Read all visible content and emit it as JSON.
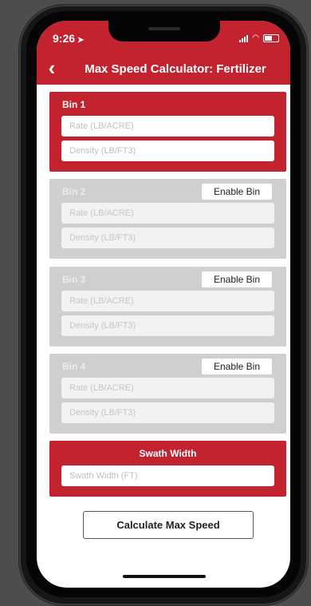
{
  "status_bar": {
    "time": "9:26",
    "location_glyph": "➤"
  },
  "header": {
    "back_glyph": "‹",
    "title": "Max Speed Calculator: Fertilizer"
  },
  "bins": [
    {
      "title": "Bin 1",
      "enabled": true,
      "rate_placeholder": "Rate (LB/ACRE)",
      "density_placeholder": "Density (LB/FT3)"
    },
    {
      "title": "Bin 2",
      "enabled": false,
      "enable_label": "Enable Bin",
      "rate_placeholder": "Rate (LB/ACRE)",
      "density_placeholder": "Density (LB/FT3)"
    },
    {
      "title": "Bin 3",
      "enabled": false,
      "enable_label": "Enable Bin",
      "rate_placeholder": "Rate (LB/ACRE)",
      "density_placeholder": "Density (LB/FT3)"
    },
    {
      "title": "Bin 4",
      "enabled": false,
      "enable_label": "Enable Bin",
      "rate_placeholder": "Rate (LB/ACRE)",
      "density_placeholder": "Density (LB/FT3)"
    }
  ],
  "swath": {
    "title": "Swath Width",
    "placeholder": "Swath Width (FT)"
  },
  "calculate_button": {
    "label": "Calculate Max Speed"
  },
  "colors": {
    "accent": "#c3222f",
    "disabled": "#cfcfcf",
    "background": "#4d4d4d"
  }
}
